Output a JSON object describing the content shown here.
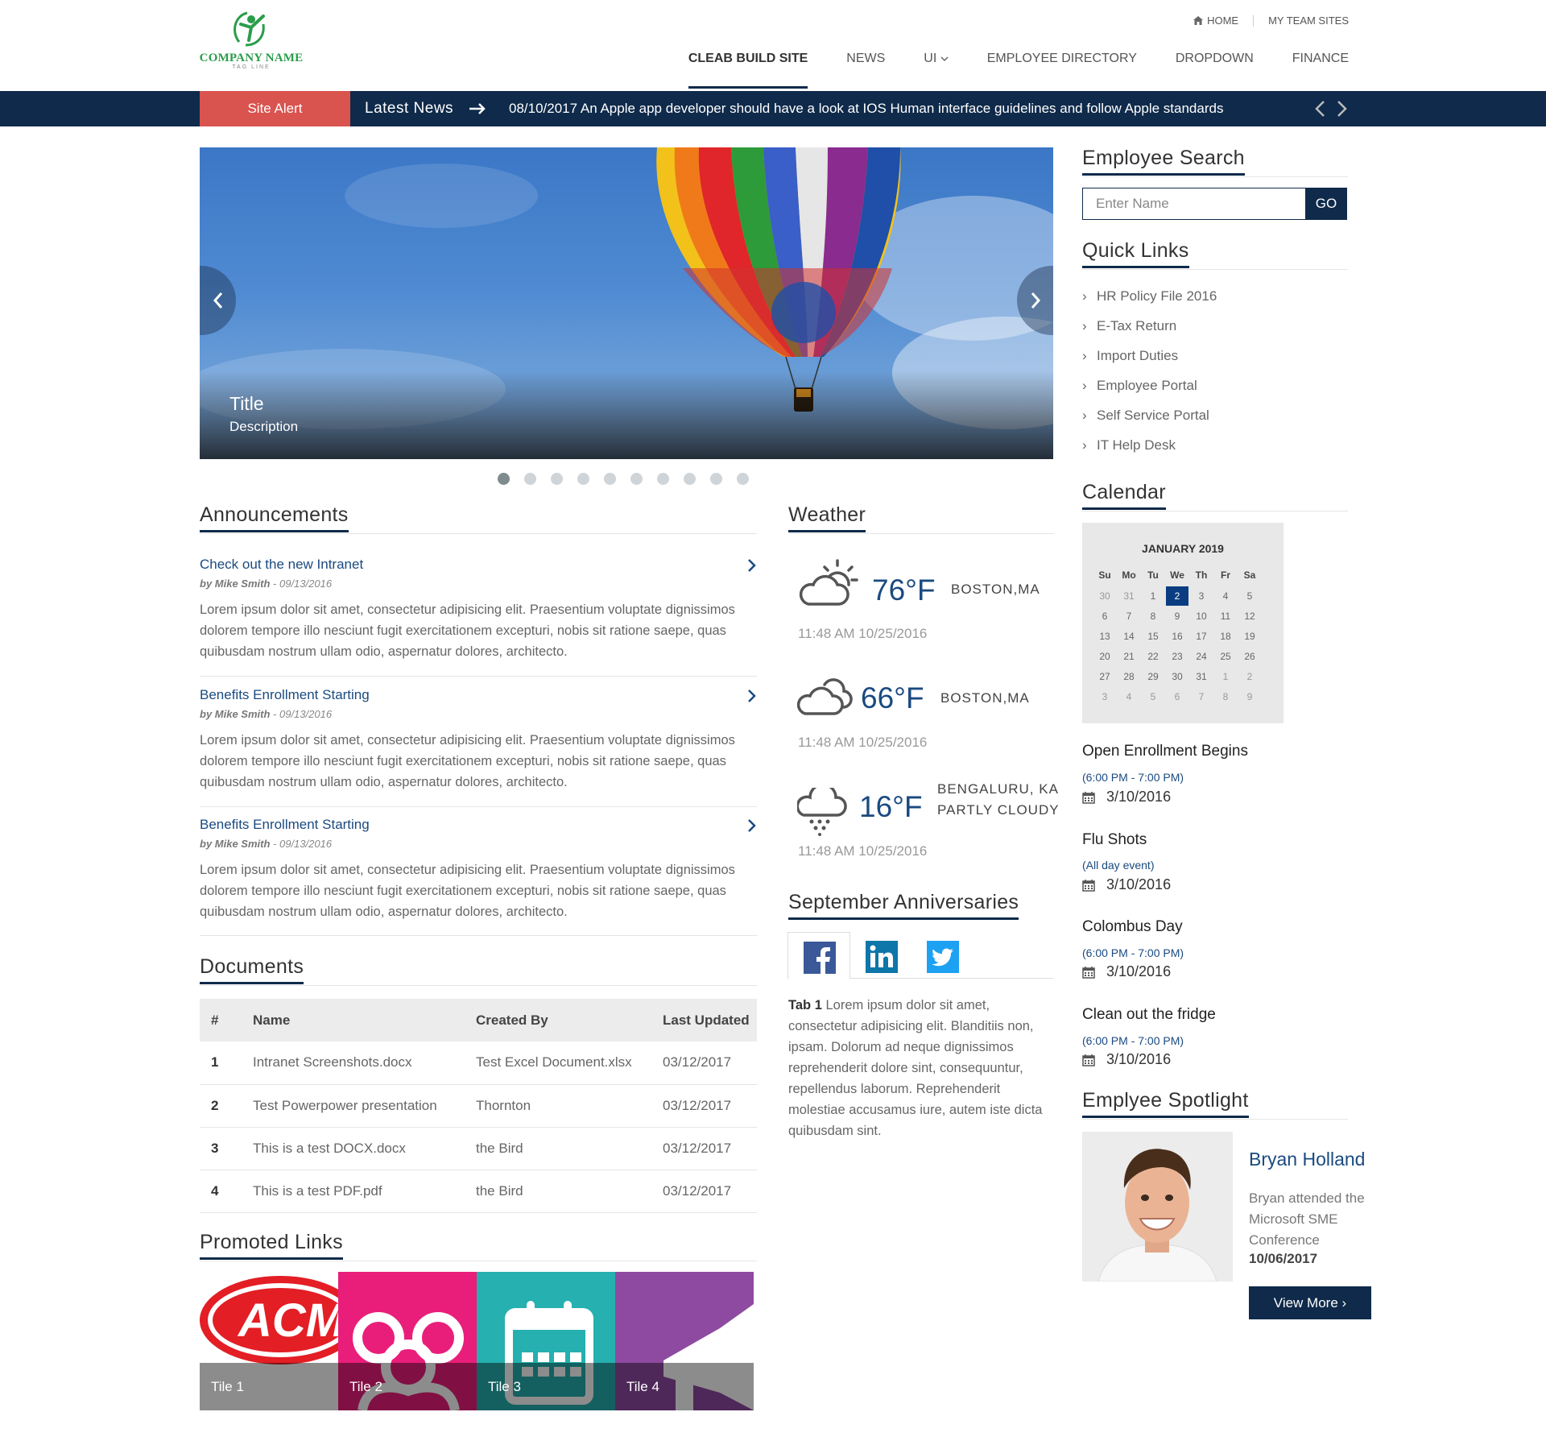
{
  "brand": {
    "company_name": "COMPANY NAME",
    "tag_line": "TAG LINE"
  },
  "top_links": [
    "HOME",
    "MY TEAM SITES"
  ],
  "nav": {
    "items": [
      "CLEAB BUILD SITE",
      "NEWS",
      "UI",
      "EMPLOYEE DIRECTORY",
      "DROPDOWN",
      "FINANCE"
    ],
    "active": "CLEAB BUILD SITE"
  },
  "news_bar": {
    "alert": "Site Alert",
    "latest_label": "Latest News",
    "text": "08/10/2017 An Apple app developer should have a look at IOS Human interface guidelines and follow Apple standards"
  },
  "carousel": {
    "title": "Title",
    "description": "Description",
    "slide_count": 10,
    "active_index": 0
  },
  "announcements": {
    "heading": "Announcements",
    "items": [
      {
        "title": "Check out the new Intranet",
        "author": "by Mike Smith",
        "date": "- 09/13/2016",
        "body": "Lorem ipsum dolor sit amet, consectetur adipisicing elit. Praesentium voluptate dignissimos dolorem tempore illo nesciunt fugit exercitationem excepturi, nobis sit ratione saepe, quas quibusdam nostrum ullam odio, aspernatur dolores, architecto."
      },
      {
        "title": "Benefits Enrollment Starting",
        "author": "by Mike Smith",
        "date": "- 09/13/2016",
        "body": "Lorem ipsum dolor sit amet, consectetur adipisicing elit. Praesentium voluptate dignissimos dolorem tempore illo nesciunt fugit exercitationem excepturi, nobis sit ratione saepe, quas quibusdam nostrum ullam odio, aspernatur dolores, architecto."
      },
      {
        "title": "Benefits Enrollment Starting",
        "author": "by Mike Smith",
        "date": "- 09/13/2016",
        "body": "Lorem ipsum dolor sit amet, consectetur adipisicing elit. Praesentium voluptate dignissimos dolorem tempore illo nesciunt fugit exercitationem excepturi, nobis sit ratione saepe, quas quibusdam nostrum ullam odio, aspernatur dolores, architecto."
      }
    ]
  },
  "documents": {
    "heading": "Documents",
    "columns": [
      "#",
      "Name",
      "Created By",
      "Last Updated"
    ],
    "rows": [
      [
        "1",
        "Intranet Screenshots.docx",
        "Test Excel Document.xlsx",
        "03/12/2017"
      ],
      [
        "2",
        "Test Powerpower presentation",
        "Thornton",
        "03/12/2017"
      ],
      [
        "3",
        "This is a test DOCX.docx",
        "the Bird",
        "03/12/2017"
      ],
      [
        "4",
        "This is a test PDF.pdf",
        "the Bird",
        "03/12/2017"
      ]
    ]
  },
  "promoted_links": {
    "heading": "Promoted Links",
    "tiles": [
      {
        "label": "Tile 1",
        "color": "#ffffff",
        "art": "ACME"
      },
      {
        "label": "Tile 2",
        "color": "#e91e7a"
      },
      {
        "label": "Tile 3",
        "color": "#26b0b0"
      },
      {
        "label": "Tile 4",
        "color": "#8e4aa0"
      }
    ]
  },
  "weather": {
    "heading": "Weather",
    "items": [
      {
        "temp": "76°F",
        "city": "BOSTON,MA",
        "condition": "",
        "time": "11:48 AM 10/25/2016",
        "icon": "partly-sunny-icon"
      },
      {
        "temp": "66°F",
        "city": "BOSTON,MA",
        "condition": "",
        "time": "11:48 AM 10/25/2016",
        "icon": "cloudy-icon"
      },
      {
        "temp": "16°F",
        "city": "BENGALURU, KA",
        "condition": "PARTLY CLOUDY",
        "time": "11:48 AM 10/25/2016",
        "icon": "rain-icon"
      }
    ]
  },
  "anniversaries": {
    "heading": "September Anniversaries",
    "tabs": [
      "facebook-icon",
      "linkedin-icon",
      "twitter-icon"
    ],
    "tab_label": "Tab 1",
    "tab_text": "Lorem ipsum dolor sit amet, consectetur adipisicing elit. Blanditiis non, ipsam. Dolorum ad neque dignissimos reprehenderit dolore sint, consequuntur, repellendus laborum. Reprehenderit molestiae accusamus iure, autem iste dicta quibusdam sint."
  },
  "employee_search": {
    "heading": "Employee Search",
    "placeholder": "Enter Name",
    "button": "GO"
  },
  "quick_links": {
    "heading": "Quick Links",
    "items": [
      "HR Policy File 2016",
      "E-Tax Return",
      "Import Duties",
      "Employee Portal",
      "Self Service Portal",
      "IT Help Desk"
    ]
  },
  "calendar": {
    "heading": "Calendar",
    "month_title": "JANUARY 2019",
    "weekdays": [
      "Su",
      "Mo",
      "Tu",
      "We",
      "Th",
      "Fr",
      "Sa"
    ],
    "weeks": [
      [
        "30",
        "31",
        "1",
        "2",
        "3",
        "4",
        "5"
      ],
      [
        "6",
        "7",
        "8",
        "9",
        "10",
        "11",
        "12"
      ],
      [
        "13",
        "14",
        "15",
        "16",
        "17",
        "18",
        "19"
      ],
      [
        "20",
        "21",
        "22",
        "23",
        "24",
        "25",
        "26"
      ],
      [
        "27",
        "28",
        "29",
        "30",
        "31",
        "1",
        "2"
      ],
      [
        "3",
        "4",
        "5",
        "6",
        "7",
        "8",
        "9"
      ]
    ],
    "selected": "2",
    "events": [
      {
        "title": "Open Enrollment Begins",
        "time": "(6:00 PM - 7:00 PM)",
        "date": "3/10/2016"
      },
      {
        "title": "Flu Shots",
        "time": "(All day event)",
        "date": "3/10/2016"
      },
      {
        "title": "Colombus Day",
        "time": "(6:00 PM - 7:00 PM)",
        "date": "3/10/2016"
      },
      {
        "title": "Clean out the fridge",
        "time": "(6:00 PM - 7:00 PM)",
        "date": "3/10/2016"
      }
    ]
  },
  "spotlight": {
    "heading": "Emplyee Spotlight",
    "name": "Bryan Holland",
    "description": "Bryan attended the Microsoft SME Conference",
    "date": "10/06/2017",
    "button": "View More"
  },
  "colors": {
    "navy": "#0f2a4a",
    "alert_red": "#d9534f",
    "link_blue": "#1a4a80",
    "brand_green": "#2a9d4a"
  }
}
